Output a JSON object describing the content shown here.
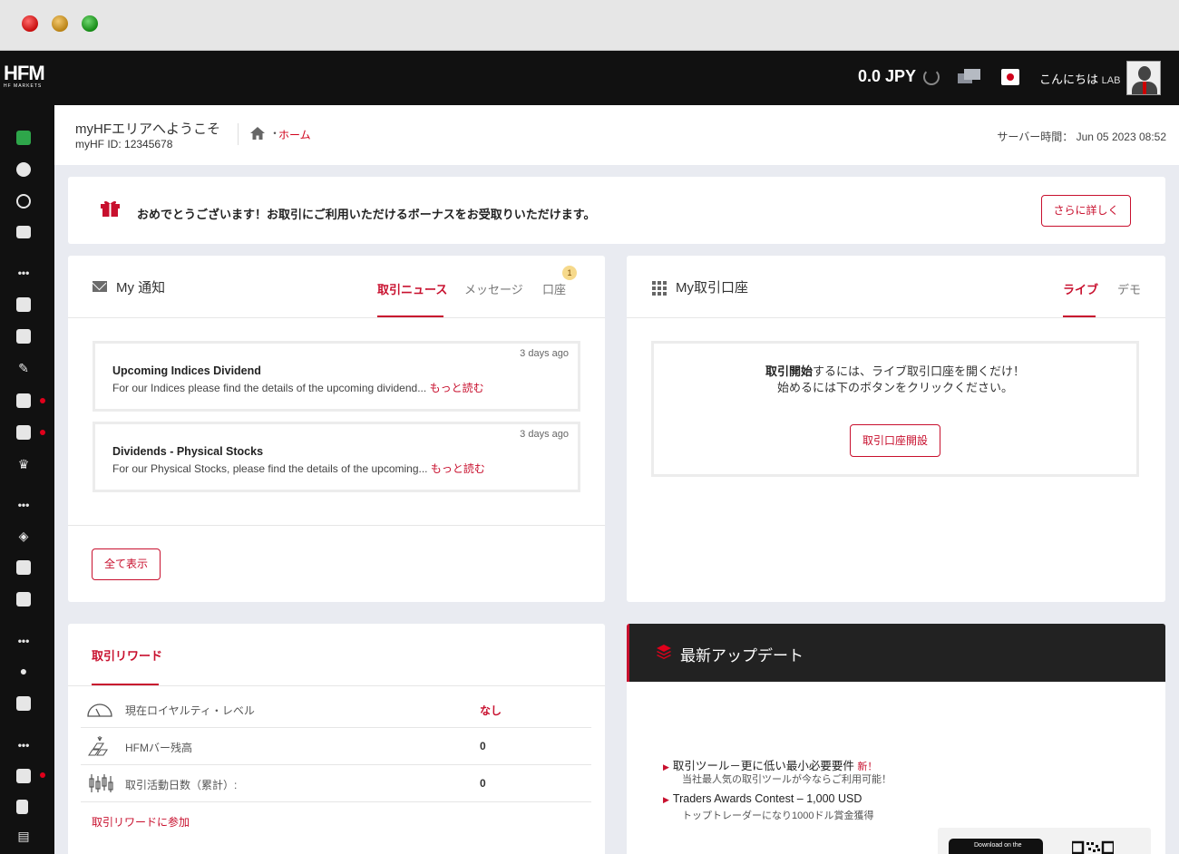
{
  "topbar": {
    "logo_main": "HFM",
    "logo_sub": "HF MARKETS",
    "balance": "0.0 JPY",
    "greeting": "こんにちは",
    "user": "LAB"
  },
  "sidebar": {
    "icons": [
      "wallet-icon",
      "pie-chart-icon",
      "user-circle-icon",
      "card-icon",
      "more-icon",
      "grid-icon",
      "chart-icon",
      "tag-icon",
      "list-icon",
      "gift-icon",
      "trophy-icon",
      "more-icon",
      "layers-icon",
      "wave-chart-icon",
      "wave-chart-icon",
      "more-icon",
      "person-icon",
      "document-icon",
      "more-icon",
      "calendar-icon",
      "copy-icon",
      "chat-icon"
    ]
  },
  "header": {
    "welcome": "myHFエリアへようこそ",
    "id_label": "myHF ID:",
    "id_value": "12345678",
    "breadcrumb_sep": "・",
    "breadcrumb_home": "ホーム",
    "server_label": "サーバー時間：",
    "server_time": "Jun 05 2023 08:52"
  },
  "banner": {
    "text": "おめでとうございます！お取引にご利用いただけるボーナスをお受取りいただけます。",
    "button": "さらに詳しく"
  },
  "notifications": {
    "title": "My 通知",
    "tabs": [
      {
        "label": "取引ニュース",
        "active": true
      },
      {
        "label": "メッセージ",
        "active": false
      },
      {
        "label": "口座",
        "active": false,
        "badge": "1"
      }
    ],
    "items": [
      {
        "age": "3 days ago",
        "title": "Upcoming Indices Dividend",
        "body": "For our Indices please find the details of the upcoming dividend...",
        "more": "もっと読む"
      },
      {
        "age": "3 days ago",
        "title": "Dividends - Physical Stocks",
        "body": "For our Physical Stocks, please find the details of the upcoming...",
        "more": "もっと読む"
      }
    ],
    "show_all": "全て表示"
  },
  "accounts": {
    "title": "My取引口座",
    "tabs": [
      {
        "label": "ライブ",
        "active": true
      },
      {
        "label": "デモ",
        "active": false
      }
    ],
    "line1_bold": "取引開始",
    "line1_rest": "するには、ライブ取引口座を開くだけ！",
    "line2": "始めるには下のボタンをクリックください。",
    "button": "取引口座開設"
  },
  "rewards": {
    "title": "取引リワード",
    "rows": [
      {
        "label": "現在ロイヤルティ・レベル",
        "value": "なし",
        "icon": "gauge-icon"
      },
      {
        "label": "HFMバー残高",
        "value": "0",
        "icon": "gold-bars-icon"
      },
      {
        "label": "取引活動日数（累計）:",
        "value": "0",
        "icon": "candlestick-icon"
      }
    ],
    "join_link": "取引リワードに参加"
  },
  "updates": {
    "title": "最新アップデート",
    "items": [
      {
        "title": "取引ツール－更に低い最小必要要件",
        "new": "新！",
        "sub": "当社最人気の取引ツールが今ならご利用可能！"
      },
      {
        "title": "Traders Awards Contest – 1,000 USD",
        "new": "",
        "sub": "トップトレーダーになり1000ドル賞金獲得"
      }
    ],
    "store_badge": "Download on the"
  },
  "colors": {
    "accent": "#c8102e",
    "topbar": "#111111",
    "background": "#e9ebf1"
  }
}
